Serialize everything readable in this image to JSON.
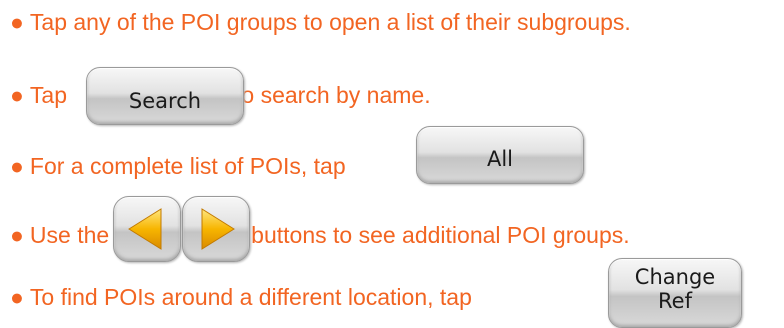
{
  "bullet": "●",
  "lines": [
    {
      "text": "Tap any of the POI groups to open a list of their subgroups."
    },
    {
      "before": "Tap",
      "after": "to search by name."
    },
    {
      "before": "For a complete list of POIs, tap",
      "after": "."
    },
    {
      "before": "Use the",
      "after": "buttons to see additional POI groups."
    },
    {
      "before": "To find POIs around a different location, tap",
      "after": "."
    }
  ],
  "buttons": {
    "search": "Search",
    "all": "All",
    "change_ref_line1": "Change",
    "change_ref_line2": "Ref"
  },
  "icons": {
    "prev": "arrow-left-icon",
    "next": "arrow-right-icon"
  },
  "colors": {
    "text": "#f26522",
    "arrow": "#f7b500"
  }
}
